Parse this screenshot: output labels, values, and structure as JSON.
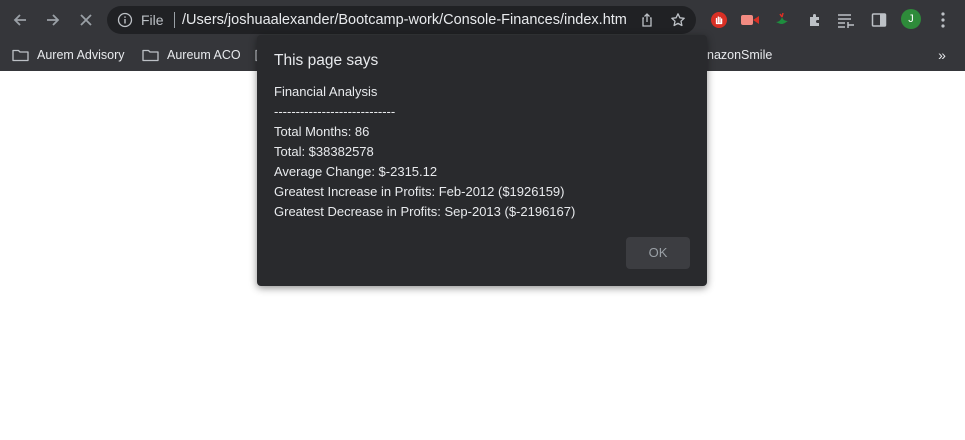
{
  "omnibox": {
    "scheme_label": "File",
    "url": "/Users/joshuaalexander/Bootcamp-work/Console-Finances/index.html"
  },
  "bookmarks": {
    "items": [
      {
        "label": "Aurem Advisory"
      },
      {
        "label": "Aureum ACO"
      },
      {
        "label": "nazonSmile"
      }
    ],
    "more_label": "»"
  },
  "profile": {
    "initial": "J",
    "color": "#2e8b3a"
  },
  "dialog": {
    "title": "This page says",
    "lines": [
      "Financial Analysis",
      "----------------------------",
      "Total Months: 86",
      "Total: $38382578",
      "Average Change: $-2315.12",
      "Greatest Increase in Profits: Feb-2012 ($1926159)",
      "Greatest Decrease in Profits: Sep-2013 ($-2196167)"
    ],
    "ok_label": "OK"
  },
  "icons": {
    "toolbar": [
      "back-icon",
      "forward-icon",
      "stop-loading-icon"
    ],
    "omnibox": [
      "info-icon",
      "share-icon",
      "bookmark-star-icon"
    ],
    "extensions": [
      "stop-hand-extension-icon",
      "video-extension-icon",
      "bird-extension-icon",
      "extensions-puzzle-icon",
      "reading-list-icon",
      "side-panel-icon",
      "menu-kebab-icon"
    ]
  },
  "colors": {
    "chrome_bg": "#35363a",
    "omnibox_bg": "#202124",
    "dialog_bg": "#292a2d",
    "button_bg": "#3c3d41"
  }
}
